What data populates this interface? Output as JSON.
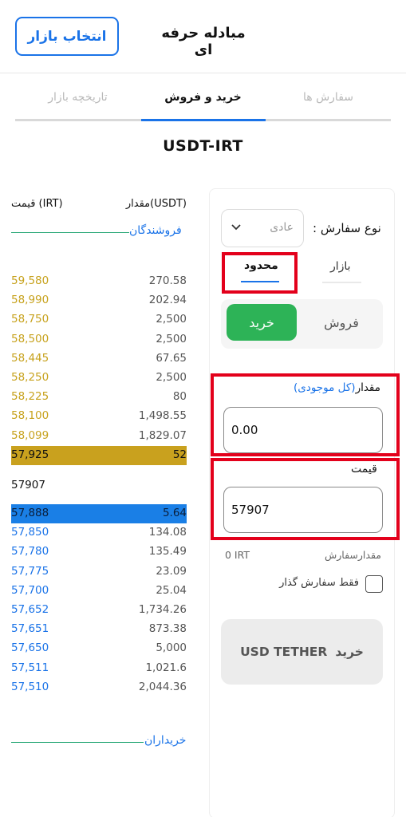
{
  "header": {
    "market_button": "انتخاب بازار",
    "title": "مبادله حرفه ای"
  },
  "tabs": [
    {
      "label": "سفارش ها"
    },
    {
      "label": "خرید و فروش"
    },
    {
      "label": "تاریخچه بازار"
    }
  ],
  "pair": "USDT-IRT",
  "orderbook": {
    "price_header": "قیمت (IRT)",
    "amount_header": "مقدار(USDT)",
    "sellers_label": "فروشندگان",
    "buyers_label": "خریداران",
    "asks": [
      {
        "price": "59,580",
        "amount": "270.58"
      },
      {
        "price": "58,990",
        "amount": "202.94"
      },
      {
        "price": "58,750",
        "amount": "2,500"
      },
      {
        "price": "58,500",
        "amount": "2,500"
      },
      {
        "price": "58,445",
        "amount": "67.65"
      },
      {
        "price": "58,250",
        "amount": "2,500"
      },
      {
        "price": "58,225",
        "amount": "80"
      },
      {
        "price": "58,100",
        "amount": "1,498.55"
      },
      {
        "price": "58,099",
        "amount": "1,829.07"
      },
      {
        "price": "57,925",
        "amount": "52"
      }
    ],
    "last_price": "57907",
    "bids": [
      {
        "price": "57,888",
        "amount": "5.64"
      },
      {
        "price": "57,850",
        "amount": "134.08"
      },
      {
        "price": "57,780",
        "amount": "135.49"
      },
      {
        "price": "57,775",
        "amount": "23.09"
      },
      {
        "price": "57,700",
        "amount": "25.04"
      },
      {
        "price": "57,652",
        "amount": "1,734.26"
      },
      {
        "price": "57,651",
        "amount": "873.38"
      },
      {
        "price": "57,650",
        "amount": "5,000"
      },
      {
        "price": "57,511",
        "amount": "1,021.6"
      },
      {
        "price": "57,510",
        "amount": "2,044.36"
      }
    ]
  },
  "form": {
    "order_type_label": "نوع سفارش :",
    "order_type_value": "عادی",
    "subtab_market": "بازار",
    "subtab_limit": "محدود",
    "buy": "خرید",
    "sell": "فروش",
    "amount_label": "مقدار",
    "amount_link": "(کل موجودی)",
    "amount_value": "0.00",
    "price_label": "قیمت",
    "price_value": "57907",
    "order_amount_label": "مقدارسفارش",
    "order_amount_value": "0 IRT",
    "maker_only": "فقط سفارش گذار",
    "submit_word": "خرید",
    "submit_asset": "USD TETHER"
  },
  "colors": {
    "accent": "#1a73e8",
    "buy_green": "#2db357",
    "ask_gold": "#c7a21d",
    "highlight_red": "#e3001b"
  }
}
